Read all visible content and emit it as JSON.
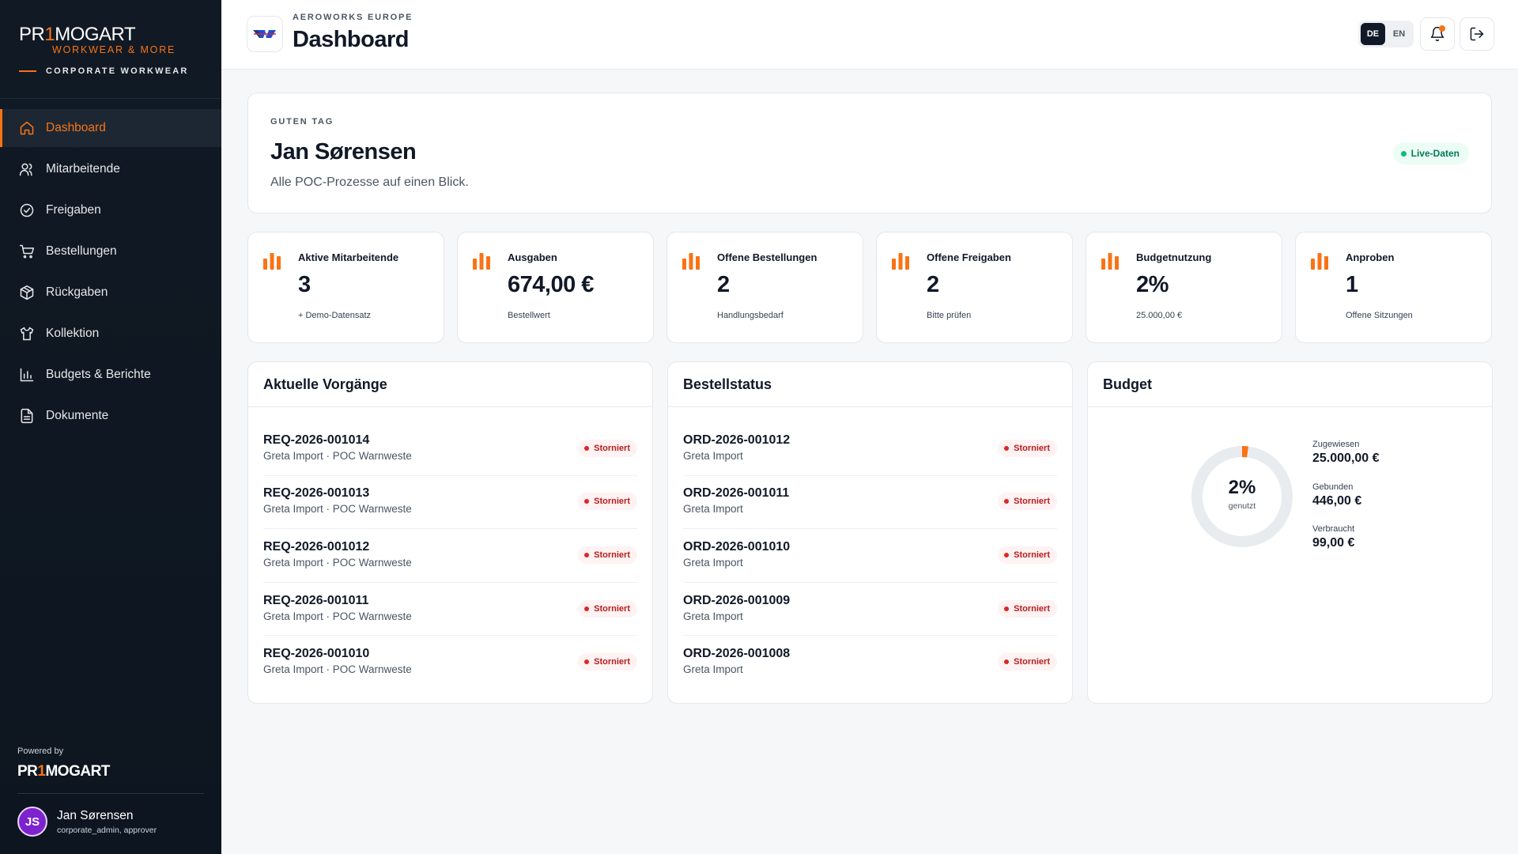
{
  "brand": {
    "name_pre": "PR",
    "name_accent": "1",
    "name_post": "MOGART",
    "tagline": "WORKWEAR & MORE",
    "subtitle": "CORPORATE WORKWEAR"
  },
  "sidebar": {
    "items": [
      {
        "label": "Dashboard",
        "icon": "home-icon"
      },
      {
        "label": "Mitarbeitende",
        "icon": "users-icon"
      },
      {
        "label": "Freigaben",
        "icon": "check-circle-icon"
      },
      {
        "label": "Bestellungen",
        "icon": "cart-icon"
      },
      {
        "label": "Rückgaben",
        "icon": "package-icon"
      },
      {
        "label": "Kollektion",
        "icon": "shirt-icon"
      },
      {
        "label": "Budgets & Berichte",
        "icon": "bar-chart-icon"
      },
      {
        "label": "Dokumente",
        "icon": "document-icon"
      }
    ],
    "powered_by": "Powered by"
  },
  "user": {
    "initials": "JS",
    "name": "Jan Sørensen",
    "roles": "corporate_admin, approver"
  },
  "header": {
    "org": "AEROWORKS EUROPE",
    "title": "Dashboard",
    "lang_de": "DE",
    "lang_en": "EN",
    "active_lang": "DE"
  },
  "welcome": {
    "greeting": "GUTEN TAG",
    "name": "Jan Sørensen",
    "subtitle": "Alle POC-Prozesse auf einen Blick.",
    "live_label": "Live-Daten"
  },
  "stats": [
    {
      "label": "Aktive Mitarbeitende",
      "value": "3",
      "sub": "+ Demo-Datensatz"
    },
    {
      "label": "Ausgaben",
      "value": "674,00 €",
      "sub": "Bestellwert"
    },
    {
      "label": "Offene Bestellungen",
      "value": "2",
      "sub": "Handlungsbedarf"
    },
    {
      "label": "Offene Freigaben",
      "value": "2",
      "sub": "Bitte prüfen"
    },
    {
      "label": "Budgetnutzung",
      "value": "2%",
      "sub": "25.000,00 €"
    },
    {
      "label": "Anproben",
      "value": "1",
      "sub": "Offene Sitzungen"
    }
  ],
  "activities": {
    "title": "Aktuelle Vorgänge",
    "rows": [
      {
        "id": "REQ-2026-001014",
        "sub": "Greta Import · POC Warnweste",
        "status": "Storniert"
      },
      {
        "id": "REQ-2026-001013",
        "sub": "Greta Import · POC Warnweste",
        "status": "Storniert"
      },
      {
        "id": "REQ-2026-001012",
        "sub": "Greta Import · POC Warnweste",
        "status": "Storniert"
      },
      {
        "id": "REQ-2026-001011",
        "sub": "Greta Import · POC Warnweste",
        "status": "Storniert"
      },
      {
        "id": "REQ-2026-001010",
        "sub": "Greta Import · POC Warnweste",
        "status": "Storniert"
      }
    ]
  },
  "orders": {
    "title": "Bestellstatus",
    "rows": [
      {
        "id": "ORD-2026-001012",
        "sub": "Greta Import",
        "status": "Storniert"
      },
      {
        "id": "ORD-2026-001011",
        "sub": "Greta Import",
        "status": "Storniert"
      },
      {
        "id": "ORD-2026-001010",
        "sub": "Greta Import",
        "status": "Storniert"
      },
      {
        "id": "ORD-2026-001009",
        "sub": "Greta Import",
        "status": "Storniert"
      },
      {
        "id": "ORD-2026-001008",
        "sub": "Greta Import",
        "status": "Storniert"
      }
    ]
  },
  "budget": {
    "title": "Budget",
    "percent_label": "2%",
    "percent_fraction": 0.02,
    "used_label": "genutzt",
    "assigned_label": "Zugewiesen",
    "assigned_value": "25.000,00 €",
    "bound_label": "Gebunden",
    "bound_value": "446,00 €",
    "spent_label": "Verbraucht",
    "spent_value": "99,00 €"
  },
  "colors": {
    "accent": "#f97316",
    "sidebar_bg": "#111a24",
    "status_cancelled": "#b91c1c",
    "live": "#047857"
  }
}
